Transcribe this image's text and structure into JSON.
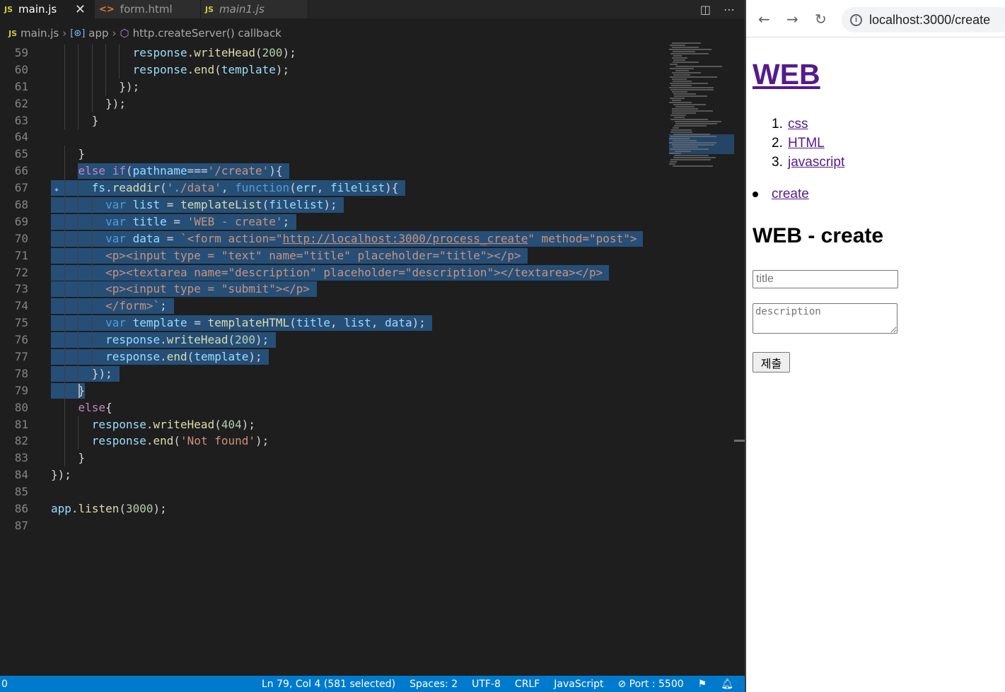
{
  "editor": {
    "tabs": [
      {
        "label": "main.js",
        "type": "js",
        "active": true
      },
      {
        "label": "form.html",
        "type": "html",
        "active": false
      },
      {
        "label": "main1.js",
        "type": "js",
        "active": false,
        "italic": true
      }
    ],
    "breadcrumb": [
      "main.js",
      "app",
      "http.createServer() callback"
    ],
    "lines": [
      {
        "n": "59",
        "t": "            response.writeHead(200);"
      },
      {
        "n": "60",
        "t": "            response.end(template);"
      },
      {
        "n": "61",
        "t": "          });"
      },
      {
        "n": "62",
        "t": "        });"
      },
      {
        "n": "63",
        "t": "      }"
      },
      {
        "n": "64",
        "t": ""
      },
      {
        "n": "65",
        "t": "    }"
      },
      {
        "n": "66",
        "t": "    else if(pathname==='/create'){"
      },
      {
        "n": "67",
        "t": "      fs.readdir('./data', function(err, filelist){"
      },
      {
        "n": "68",
        "t": "        var list = templateList(filelist);"
      },
      {
        "n": "69",
        "t": "        var title = 'WEB - create';"
      },
      {
        "n": "70",
        "t": "        var data = `<form action=\"http://localhost:3000/process_create\" method=\"post\">"
      },
      {
        "n": "71",
        "t": "        <p><input type = \"text\" name=\"title\" placeholder=\"title\"></p>"
      },
      {
        "n": "72",
        "t": "        <p><textarea name=\"description\" placeholder=\"description\"></textarea></p>"
      },
      {
        "n": "73",
        "t": "        <p><input type = \"submit\"></p>"
      },
      {
        "n": "74",
        "t": "        </form>`;"
      },
      {
        "n": "75",
        "t": "        var template = templateHTML(title, list, data);"
      },
      {
        "n": "76",
        "t": "        response.writeHead(200);"
      },
      {
        "n": "77",
        "t": "        response.end(template);"
      },
      {
        "n": "78",
        "t": "      });"
      },
      {
        "n": "79",
        "t": "    }"
      },
      {
        "n": "80",
        "t": "    else{"
      },
      {
        "n": "81",
        "t": "      response.writeHead(404);"
      },
      {
        "n": "82",
        "t": "      response.end('Not found');"
      },
      {
        "n": "83",
        "t": "    }"
      },
      {
        "n": "84",
        "t": "});"
      },
      {
        "n": "85",
        "t": ""
      },
      {
        "n": "86",
        "t": "app.listen(3000);"
      },
      {
        "n": "87",
        "t": ""
      }
    ],
    "status": {
      "left": "0",
      "position": "Ln 79, Col 4 (581 selected)",
      "spaces": "Spaces: 2",
      "encoding": "UTF-8",
      "eol": "CRLF",
      "language": "JavaScript",
      "port": "Port : 5500"
    },
    "colors": {
      "statusbar": "#007acc",
      "selection": "#264f78",
      "background": "#1e1e1e"
    }
  },
  "browser": {
    "url": "localhost:3000/create",
    "page": {
      "title": "WEB",
      "list": [
        {
          "num": "1.",
          "label": "css"
        },
        {
          "num": "2.",
          "label": "HTML"
        },
        {
          "num": "3.",
          "label": "javascript"
        }
      ],
      "create_link": "create",
      "heading": "WEB - create",
      "title_placeholder": "title",
      "description_placeholder": "description",
      "submit_label": "제출"
    },
    "colors": {
      "link": "#551a8b"
    }
  }
}
